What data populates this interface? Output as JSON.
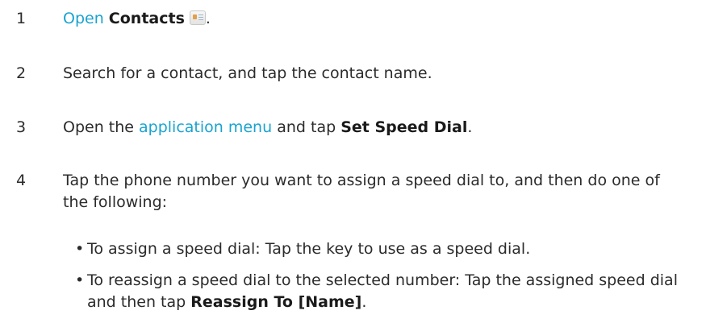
{
  "steps": [
    {
      "number": "1",
      "link": "Open",
      "bold": "Contacts",
      "icon": "contacts-app-icon",
      "end": "."
    },
    {
      "number": "2",
      "text": "Search for a contact, and tap the contact name."
    },
    {
      "number": "3",
      "pre": "Open the",
      "link": "application menu",
      "mid": "and tap",
      "bold": "Set Speed Dial",
      "end": "."
    },
    {
      "number": "4",
      "text": "Tap the phone number you want to assign a speed dial to, and then do one of the following:"
    }
  ],
  "bullets": [
    {
      "marker": "•",
      "text": "To assign a speed dial: Tap the key to use as a speed dial."
    },
    {
      "marker": "•",
      "text": "To reassign a speed dial to the selected number: Tap the assigned speed dial and then tap",
      "bold": "Reassign To [Name]",
      "end": "."
    }
  ]
}
